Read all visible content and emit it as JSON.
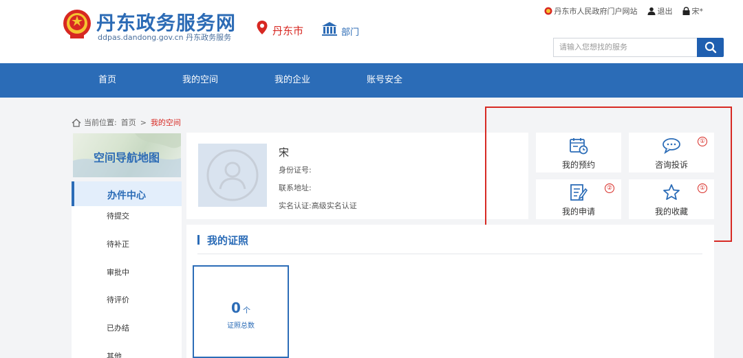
{
  "header": {
    "site_title": "丹东政务服务网",
    "site_subtitle": "ddpas.dandong.gov.cn 丹东政务服务",
    "city": "丹东市",
    "department": "部门",
    "top_links": {
      "portal": "丹东市人民政府门户网站",
      "logout": "退出",
      "user": "宋*"
    },
    "search": {
      "placeholder": "请输入您想找的服务"
    }
  },
  "nav": {
    "items": [
      "首页",
      "我的空间",
      "我的企业",
      "账号安全"
    ]
  },
  "breadcrumb": {
    "prefix": "当前位置:",
    "home": "首页",
    "separator": ">",
    "current": "我的空间"
  },
  "sidebar": {
    "banner": "空间导航地图",
    "head": "办件中心",
    "items": [
      "待提交",
      "待补正",
      "审批中",
      "待评价",
      "已办结",
      "其他"
    ]
  },
  "profile": {
    "name": "宋",
    "id_label": "身份证号:",
    "address_label": "联系地址:",
    "auth_label": "实名认证:",
    "auth_value": "高级实名认证"
  },
  "tiles": [
    {
      "label": "我的预约",
      "icon": "calendar-clock-icon",
      "badge": ""
    },
    {
      "label": "咨询投诉",
      "icon": "chat-bubble-icon",
      "badge": "①"
    },
    {
      "label": "我的申请",
      "icon": "document-edit-icon",
      "badge": "②"
    },
    {
      "label": "我的收藏",
      "icon": "star-icon",
      "badge": "①"
    }
  ],
  "certificates": {
    "title": "我的证照",
    "count": "0",
    "unit": "个",
    "count_label": "证照总数"
  },
  "colors": {
    "brand_blue": "#2b6cb7",
    "accent_red": "#d72822"
  }
}
